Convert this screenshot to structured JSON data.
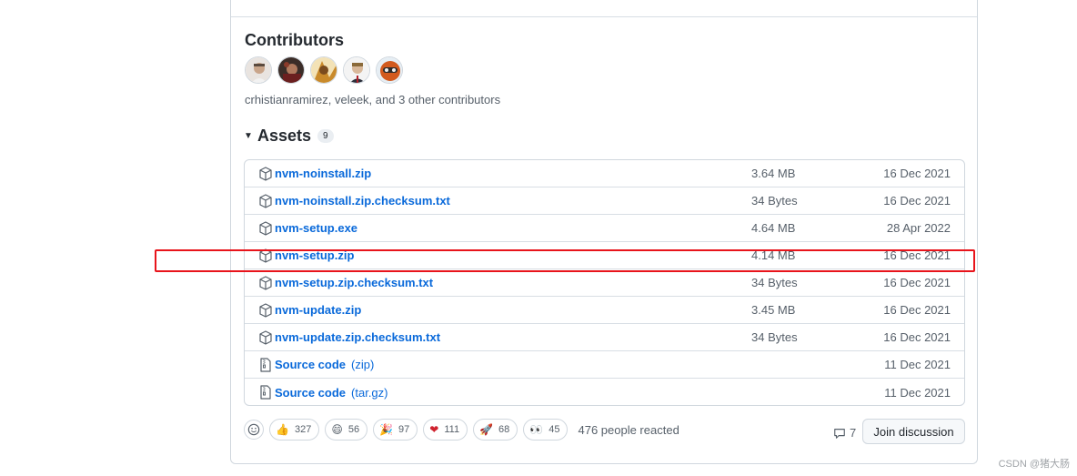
{
  "contributors": {
    "title": "Contributors",
    "summary": "crhistianramirez, veleek, and 3 other contributors",
    "avatars": [
      "avatar-1",
      "avatar-2",
      "avatar-3",
      "avatar-4",
      "avatar-5"
    ]
  },
  "assets": {
    "title": "Assets",
    "count": "9",
    "items": [
      {
        "name": "nvm-noinstall.zip",
        "suffix": "",
        "size": "3.64 MB",
        "date": "16 Dec 2021",
        "icon": "package-icon"
      },
      {
        "name": "nvm-noinstall.zip.checksum.txt",
        "suffix": "",
        "size": "34 Bytes",
        "date": "16 Dec 2021",
        "icon": "package-icon"
      },
      {
        "name": "nvm-setup.exe",
        "suffix": "",
        "size": "4.64 MB",
        "date": "28 Apr 2022",
        "icon": "package-icon"
      },
      {
        "name": "nvm-setup.zip",
        "suffix": "",
        "size": "4.14 MB",
        "date": "16 Dec 2021",
        "icon": "package-icon"
      },
      {
        "name": "nvm-setup.zip.checksum.txt",
        "suffix": "",
        "size": "34 Bytes",
        "date": "16 Dec 2021",
        "icon": "package-icon"
      },
      {
        "name": "nvm-update.zip",
        "suffix": "",
        "size": "3.45 MB",
        "date": "16 Dec 2021",
        "icon": "package-icon"
      },
      {
        "name": "nvm-update.zip.checksum.txt",
        "suffix": "",
        "size": "34 Bytes",
        "date": "16 Dec 2021",
        "icon": "package-icon"
      },
      {
        "name": "Source code",
        "suffix": "(zip)",
        "size": "",
        "date": "11 Dec 2021",
        "icon": "file-zip-icon"
      },
      {
        "name": "Source code",
        "suffix": "(tar.gz)",
        "size": "",
        "date": "11 Dec 2021",
        "icon": "file-zip-icon"
      }
    ]
  },
  "reactions": {
    "items": [
      {
        "emoji": "👍",
        "count": "327",
        "name": "thumbs-up"
      },
      {
        "emoji": "😄",
        "count": "56",
        "name": "laugh"
      },
      {
        "emoji": "🎉",
        "count": "97",
        "name": "hooray"
      },
      {
        "emoji": "❤",
        "count": "111",
        "name": "heart"
      },
      {
        "emoji": "🚀",
        "count": "68",
        "name": "rocket"
      },
      {
        "emoji": "👀",
        "count": "45",
        "name": "eyes"
      }
    ],
    "summary": "476 people reacted"
  },
  "discussion": {
    "comment_count": "7",
    "join_label": "Join discussion"
  },
  "watermark": "CSDN @猪大肠",
  "colors": {
    "link": "#0969da",
    "highlight_border": "#e8141b",
    "muted": "#57606a"
  }
}
